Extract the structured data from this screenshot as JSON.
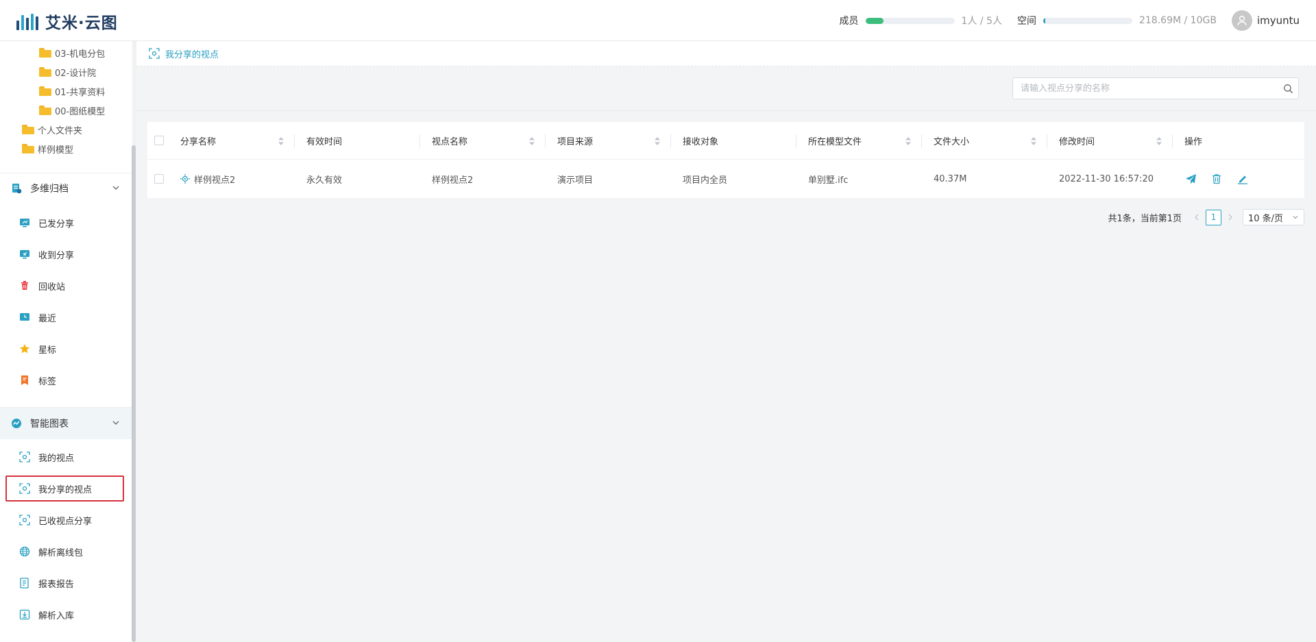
{
  "app": {
    "title": "艾米·云图"
  },
  "header": {
    "members_label": "成员",
    "members_count": "1人 / 5人",
    "members_fraction": 0.2,
    "space_label": "空间",
    "space_count": "218.69M / 10GB",
    "space_fraction": 0.021,
    "username": "imyuntu",
    "colors": {
      "members_bar": "#3dbd7d",
      "space_bar": "#2aa0c2"
    }
  },
  "sidebar": {
    "tree": [
      {
        "label": "03-机电分包"
      },
      {
        "label": "02-设计院"
      },
      {
        "label": "01-共享资料"
      },
      {
        "label": "00-图纸模型"
      },
      {
        "label": "个人文件夹"
      },
      {
        "label": "样例模型"
      }
    ],
    "group1": {
      "label": "多维归档",
      "items": [
        {
          "label": "已发分享",
          "icon": "share-sent-icon"
        },
        {
          "label": "收到分享",
          "icon": "share-received-icon"
        },
        {
          "label": "回收站",
          "icon": "trash-icon"
        },
        {
          "label": "最近",
          "icon": "recent-icon"
        },
        {
          "label": "星标",
          "icon": "star-icon"
        },
        {
          "label": "标签",
          "icon": "tag-icon"
        }
      ]
    },
    "group2": {
      "label": "智能图表",
      "items": [
        {
          "label": "我的视点",
          "icon": "viewpoint-icon"
        },
        {
          "label": "我分享的视点",
          "icon": "viewpoint-icon",
          "selected": true
        },
        {
          "label": "已收视点分享",
          "icon": "viewpoint-icon"
        },
        {
          "label": "解析离线包",
          "icon": "globe-icon"
        },
        {
          "label": "报表报告",
          "icon": "report-icon"
        },
        {
          "label": "解析入库",
          "icon": "import-icon"
        }
      ]
    }
  },
  "main": {
    "breadcrumb": "我分享的视点",
    "search_placeholder": "请输入视点分享的名称",
    "table": {
      "headers": [
        "分享名称",
        "有效时间",
        "视点名称",
        "项目来源",
        "接收对象",
        "所在模型文件",
        "文件大小",
        "修改时间",
        "操作"
      ],
      "rows": [
        {
          "share_name": "样例视点2",
          "valid_time": "永久有效",
          "view_name": "样例视点2",
          "project": "演示项目",
          "receiver": "项目内全员",
          "model_file": "单别墅.ifc",
          "size": "40.37M",
          "modified": "2022-11-30 16:57:20"
        }
      ]
    },
    "pagination": {
      "summary": "共1条，当前第1页",
      "current_page": "1",
      "page_size": "10 条/页"
    }
  }
}
